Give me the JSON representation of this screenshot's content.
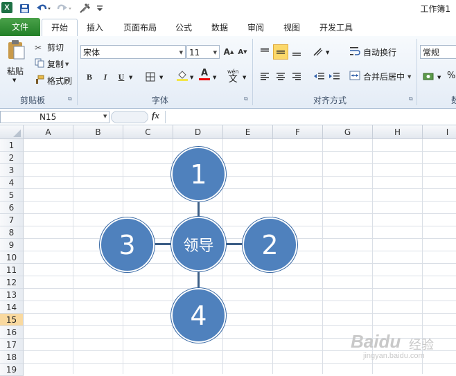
{
  "app": {
    "logo_letter": "X",
    "workbook_title": "工作簿1"
  },
  "tabs": [
    "文件",
    "开始",
    "插入",
    "页面布局",
    "公式",
    "数据",
    "审阅",
    "视图",
    "开发工具"
  ],
  "ribbon": {
    "clipboard": {
      "paste": "粘贴",
      "cut": "剪切",
      "copy": "复制",
      "format_painter": "格式刷",
      "group_label": "剪贴板"
    },
    "font": {
      "font_name": "宋体",
      "font_size": "11",
      "bold": "B",
      "italic": "I",
      "underline": "U",
      "wen": "wén",
      "wen_char": "文",
      "group_label": "字体"
    },
    "alignment": {
      "wrap_text": "自动换行",
      "merge_center": "合并后居中",
      "group_label": "对齐方式"
    },
    "number": {
      "format": "常规",
      "percent": "%",
      "group_label_partial": "数"
    }
  },
  "formula_bar": {
    "name_box": "N15",
    "fx": "fx"
  },
  "sheet": {
    "columns": [
      "A",
      "B",
      "C",
      "D",
      "E",
      "F",
      "G",
      "H",
      "I"
    ],
    "rows": [
      "1",
      "2",
      "3",
      "4",
      "5",
      "6",
      "7",
      "8",
      "9",
      "10",
      "11",
      "12",
      "13",
      "14",
      "15",
      "16",
      "17",
      "18",
      "19"
    ],
    "selected_row": "15"
  },
  "diagram": {
    "center_label": "领导",
    "top_label": "1",
    "right_label": "2",
    "left_label": "3",
    "bottom_label": "4",
    "fill_color": "#4f81bd",
    "line_color": "#3c5e86"
  },
  "watermark": {
    "brand": "Baidu",
    "suffix": "经验",
    "url": "jingyan.baidu.com"
  }
}
